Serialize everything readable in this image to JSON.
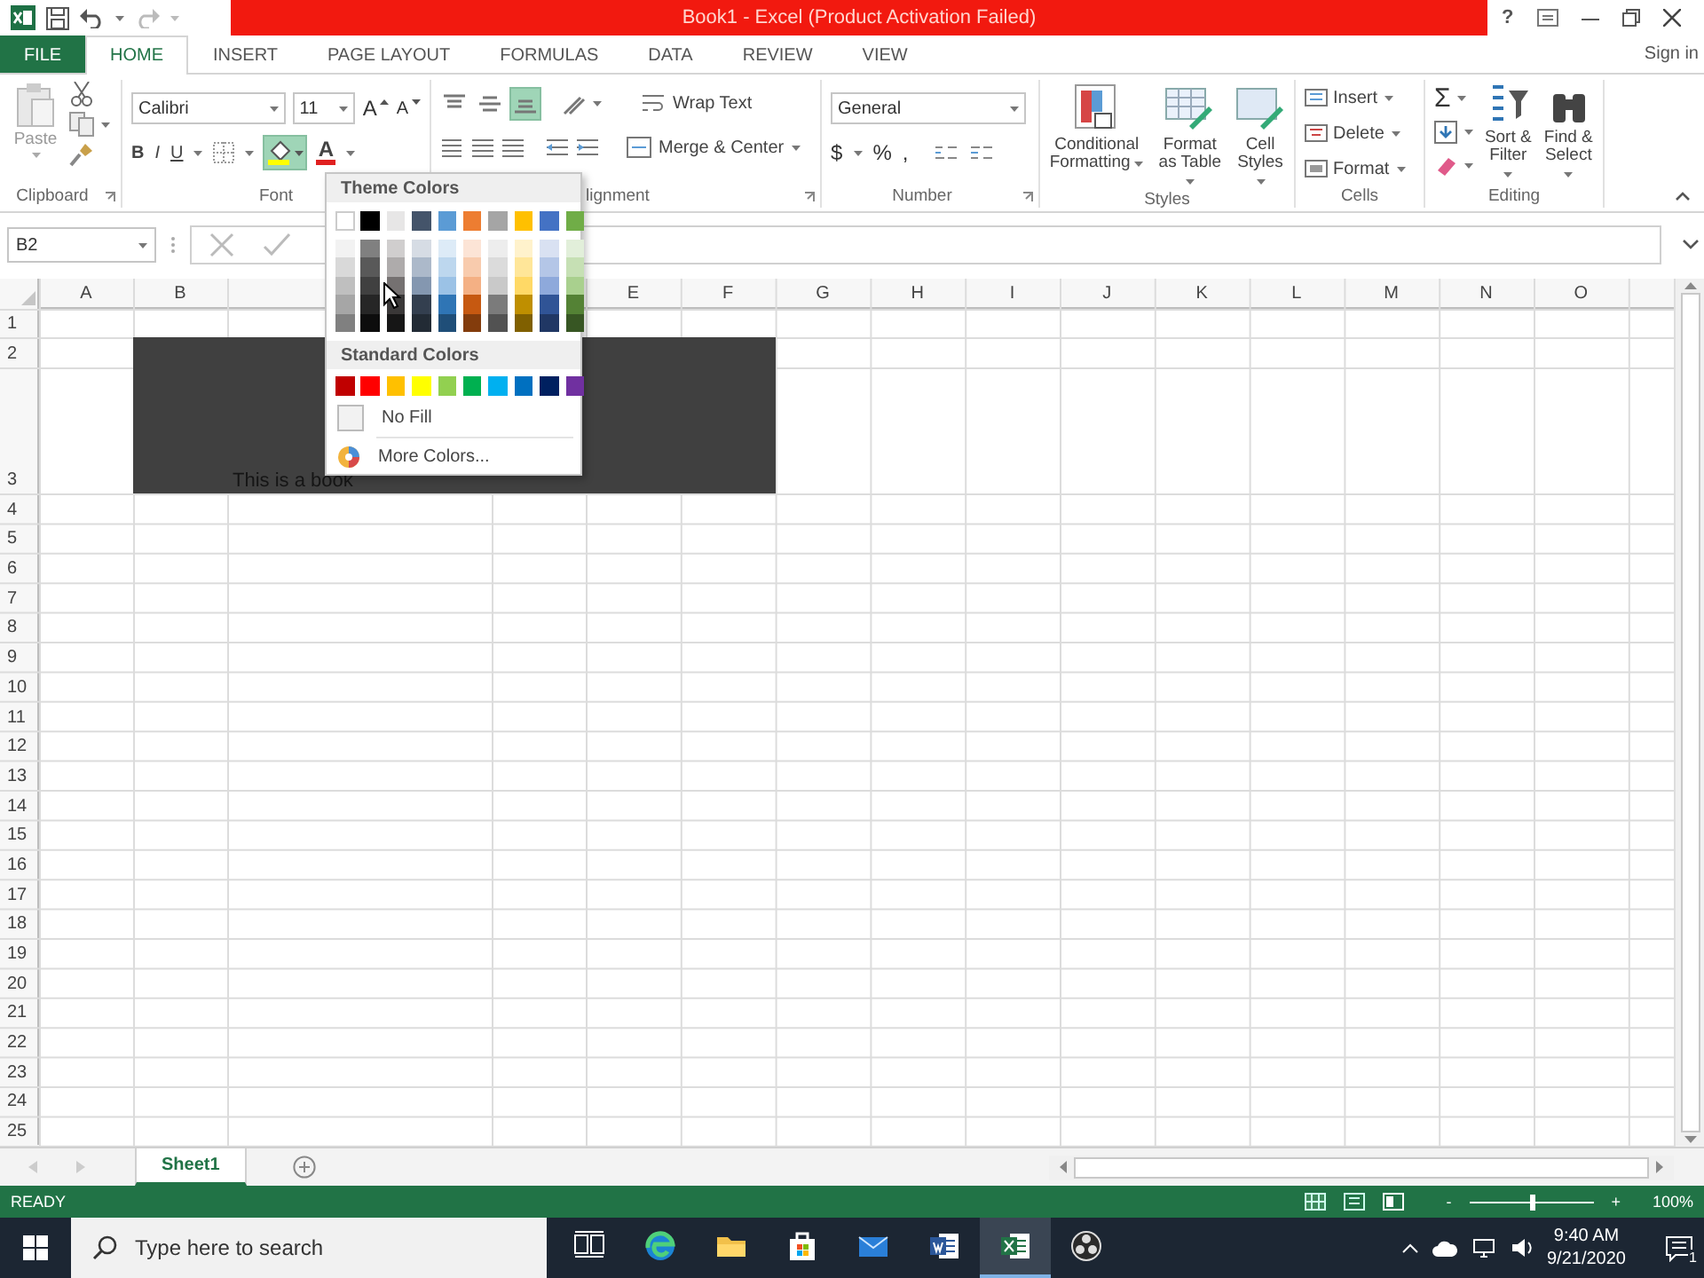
{
  "title_bar": {
    "title": "Book1 - Excel (Product Activation Failed)",
    "help": "?"
  },
  "tabs": [
    {
      "label": "FILE",
      "kind": "file",
      "selected": false
    },
    {
      "label": "HOME",
      "kind": "tab",
      "selected": true
    },
    {
      "label": "INSERT",
      "kind": "tab",
      "selected": false
    },
    {
      "label": "PAGE LAYOUT",
      "kind": "tab",
      "selected": false
    },
    {
      "label": "FORMULAS",
      "kind": "tab",
      "selected": false
    },
    {
      "label": "DATA",
      "kind": "tab",
      "selected": false
    },
    {
      "label": "REVIEW",
      "kind": "tab",
      "selected": false
    },
    {
      "label": "VIEW",
      "kind": "tab",
      "selected": false
    }
  ],
  "sign_in": "Sign in",
  "ribbon": {
    "clipboard": {
      "paste": "Paste",
      "label": "Clipboard"
    },
    "font": {
      "name": "Calibri",
      "size": "11",
      "grow": "A",
      "shrink": "A",
      "bold": "B",
      "italic": "I",
      "underline": "U",
      "fill_color_open": true,
      "font_color": "A",
      "label": "Font"
    },
    "alignment": {
      "vertical": [
        {
          "kind": "top",
          "selected": false
        },
        {
          "kind": "middle",
          "selected": false
        },
        {
          "kind": "bottom",
          "selected": true
        }
      ],
      "wrap_text": "Wrap Text",
      "merge": "Merge & Center",
      "label": "lignment"
    },
    "number": {
      "format": "General",
      "currency": "$",
      "percent": "%",
      "comma": ",",
      "label": "Number"
    },
    "styles": {
      "buttons": [
        {
          "kind": "conditional",
          "label": "Conditional Formatting"
        },
        {
          "kind": "table",
          "label": "Format as Table"
        },
        {
          "kind": "cell",
          "label": "Cell Styles"
        }
      ],
      "label": "Styles"
    },
    "cells": {
      "buttons": [
        {
          "kind": "insert",
          "label": "Insert"
        },
        {
          "kind": "delete",
          "label": "Delete"
        },
        {
          "kind": "format",
          "label": "Format"
        }
      ],
      "label": "Cells"
    },
    "editing": {
      "autosum": "Σ",
      "sort_filter": "Sort & Filter",
      "find_select": "Find & Select",
      "label": "Editing"
    }
  },
  "formula_bar": {
    "name_box": "B2"
  },
  "columns": [
    {
      "label": "A"
    },
    {
      "label": "B"
    },
    {
      "label": "E"
    },
    {
      "label": "F"
    },
    {
      "label": "G"
    },
    {
      "label": "H"
    },
    {
      "label": "I"
    },
    {
      "label": "J"
    },
    {
      "label": "K"
    },
    {
      "label": "L"
    },
    {
      "label": "M"
    },
    {
      "label": "N"
    },
    {
      "label": "O"
    }
  ],
  "rows": [
    "1",
    "2",
    "3",
    "4",
    "5",
    "6",
    "7",
    "8",
    "9",
    "10",
    "11",
    "12",
    "13",
    "14",
    "15",
    "16",
    "17",
    "18",
    "19",
    "20",
    "21",
    "22",
    "23",
    "24",
    "25"
  ],
  "sheet": {
    "fill": {
      "color": "#404040"
    },
    "cell_text": "This is a book"
  },
  "fill_menu": {
    "theme_title": "Theme Colors",
    "theme": [
      {
        "color": "#ffffff",
        "shades": [
          {
            "color": "#f2f2f2"
          },
          {
            "color": "#d9d9d9"
          },
          {
            "color": "#bfbfbf"
          },
          {
            "color": "#a6a6a6"
          },
          {
            "color": "#808080"
          }
        ]
      },
      {
        "color": "#000000",
        "shades": [
          {
            "color": "#808080"
          },
          {
            "color": "#595959"
          },
          {
            "color": "#404040"
          },
          {
            "color": "#262626"
          },
          {
            "color": "#0d0d0d"
          }
        ]
      },
      {
        "color": "#e7e6e6",
        "shades": [
          {
            "color": "#d0cece"
          },
          {
            "color": "#aeabab"
          },
          {
            "color": "#757171"
          },
          {
            "color": "#3a3838"
          },
          {
            "color": "#161616"
          }
        ]
      },
      {
        "color": "#44546a",
        "shades": [
          {
            "color": "#d6dce4"
          },
          {
            "color": "#acb9ca"
          },
          {
            "color": "#8497b0"
          },
          {
            "color": "#333f4f"
          },
          {
            "color": "#222b35"
          }
        ]
      },
      {
        "color": "#5b9bd5",
        "shades": [
          {
            "color": "#ddebf7"
          },
          {
            "color": "#bdd7ee"
          },
          {
            "color": "#9bc2e6"
          },
          {
            "color": "#2f75b5"
          },
          {
            "color": "#1f4e78"
          }
        ]
      },
      {
        "color": "#ed7d31",
        "shades": [
          {
            "color": "#fce4d6"
          },
          {
            "color": "#f8cbad"
          },
          {
            "color": "#f4b084"
          },
          {
            "color": "#c65911"
          },
          {
            "color": "#833c0c"
          }
        ]
      },
      {
        "color": "#a5a5a5",
        "shades": [
          {
            "color": "#ededed"
          },
          {
            "color": "#dbdbdb"
          },
          {
            "color": "#c9c9c9"
          },
          {
            "color": "#7b7b7b"
          },
          {
            "color": "#525252"
          }
        ]
      },
      {
        "color": "#ffc000",
        "shades": [
          {
            "color": "#fff2cc"
          },
          {
            "color": "#ffe699"
          },
          {
            "color": "#ffd966"
          },
          {
            "color": "#bf8f00"
          },
          {
            "color": "#806000"
          }
        ]
      },
      {
        "color": "#4472c4",
        "shades": [
          {
            "color": "#d9e1f2"
          },
          {
            "color": "#b4c6e7"
          },
          {
            "color": "#8ea9db"
          },
          {
            "color": "#305496"
          },
          {
            "color": "#203764"
          }
        ]
      },
      {
        "color": "#70ad47",
        "shades": [
          {
            "color": "#e2efda"
          },
          {
            "color": "#c6e0b4"
          },
          {
            "color": "#a9d08e"
          },
          {
            "color": "#548235"
          },
          {
            "color": "#375623"
          }
        ]
      }
    ],
    "standard_title": "Standard Colors",
    "standard": [
      {
        "color": "#c00000"
      },
      {
        "color": "#ff0000"
      },
      {
        "color": "#ffc000"
      },
      {
        "color": "#ffff00"
      },
      {
        "color": "#92d050"
      },
      {
        "color": "#00b050"
      },
      {
        "color": "#00b0f0"
      },
      {
        "color": "#0070c0"
      },
      {
        "color": "#002060"
      },
      {
        "color": "#7030a0"
      }
    ],
    "no_fill": "No Fill",
    "more_colors": "More Colors..."
  },
  "sheet_tabs": [
    {
      "label": "Sheet1",
      "selected": true
    }
  ],
  "status_bar": {
    "status": "READY",
    "zoom": {
      "minus": "-",
      "plus": "+",
      "level": 0.5,
      "reading": "100%"
    }
  },
  "taskbar": {
    "search_placeholder": "Type here to search",
    "apps": [
      {
        "kind": "task_view",
        "selected": false
      },
      {
        "kind": "edge",
        "selected": false
      },
      {
        "kind": "explorer",
        "selected": false
      },
      {
        "kind": "store",
        "selected": false
      },
      {
        "kind": "mail",
        "selected": false
      },
      {
        "kind": "word",
        "selected": false
      },
      {
        "kind": "excel",
        "selected": true
      },
      {
        "kind": "recorder",
        "selected": false
      }
    ],
    "time": "9:40 AM",
    "date": "9/21/2020",
    "notification_count": "1"
  }
}
